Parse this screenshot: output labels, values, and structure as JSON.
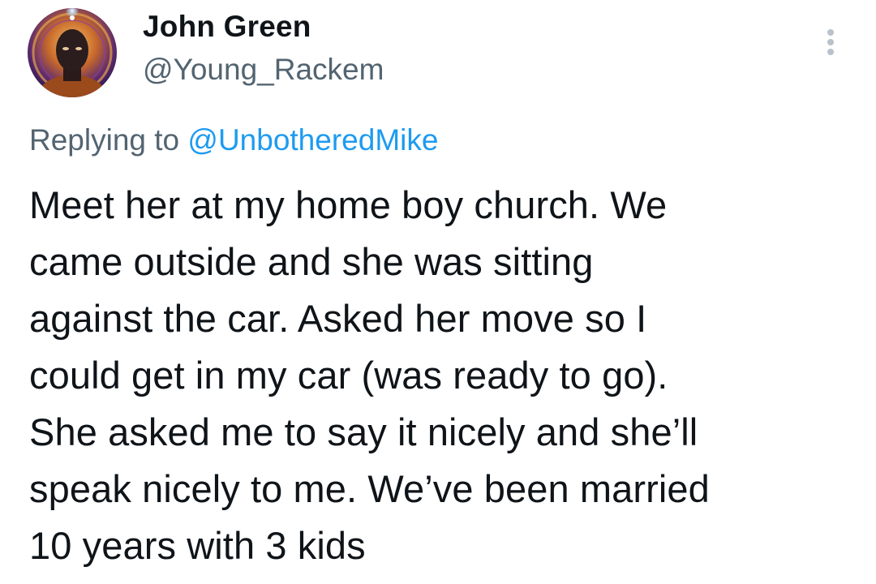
{
  "author": {
    "display_name": "John Green",
    "handle": "@Young_Rackem"
  },
  "reply": {
    "prefix": "Replying to",
    "mention": "@UnbotheredMike"
  },
  "body_lines": [
    "Meet her at my home boy church. We",
    "came outside and she was sitting",
    "against the car. Asked her move so I",
    "could get in my car (was ready to go).",
    "She asked me to say it nicely and she’ll",
    "speak nicely to me. We’ve been married",
    "10 years with 3 kids"
  ],
  "icons": {
    "more": "more-vertical-icon"
  },
  "colors": {
    "text_primary": "#0f1419",
    "text_secondary": "#536471",
    "link": "#1d9bf0"
  }
}
